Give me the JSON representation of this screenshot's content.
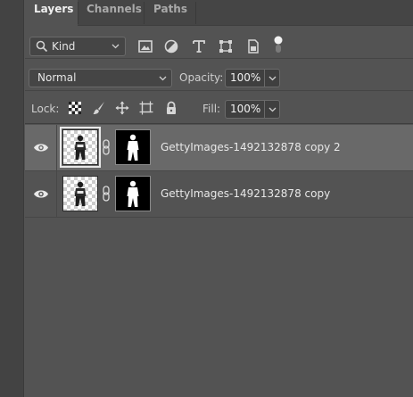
{
  "tabs": [
    {
      "label": "Layers",
      "active": true
    },
    {
      "label": "Channels",
      "active": false
    },
    {
      "label": "Paths",
      "active": false
    }
  ],
  "filter": {
    "kind_label": "Kind",
    "icons": [
      "search-icon",
      "image-filter-icon",
      "adjustment-filter-icon",
      "type-filter-icon",
      "shape-filter-icon",
      "smart-object-filter-icon",
      "filter-toggle"
    ]
  },
  "blend": {
    "mode": "Normal",
    "opacity_label": "Opacity:",
    "opacity_value": "100%"
  },
  "lock": {
    "label": "Lock:",
    "icons": [
      "lock-transparent-pixels-icon",
      "lock-image-pixels-icon",
      "lock-position-icon",
      "lock-artboard-icon",
      "lock-all-icon"
    ],
    "fill_label": "Fill:",
    "fill_value": "100%"
  },
  "layers": [
    {
      "name": "GettyImages-1492132878 copy 2",
      "selected": true,
      "visible": true
    },
    {
      "name": "GettyImages-1492132878 copy",
      "selected": false,
      "visible": true
    }
  ],
  "colors": {
    "panel_bg": "#535353",
    "selected_layer_bg": "#696969",
    "tab_bar_bg": "#454545"
  }
}
